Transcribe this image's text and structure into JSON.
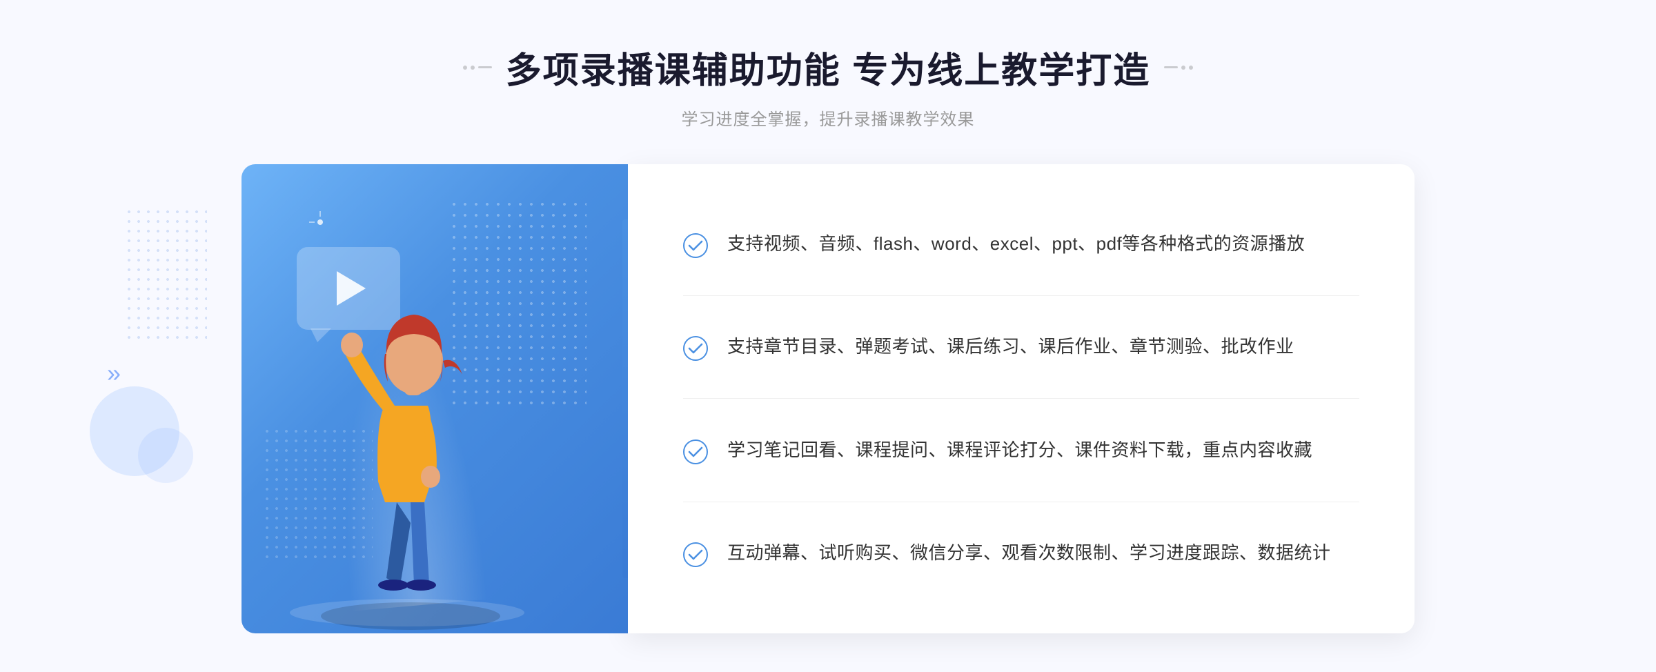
{
  "header": {
    "title": "多项录播课辅助功能 专为线上教学打造",
    "subtitle": "学习进度全掌握，提升录播课教学效果",
    "decoration_left": ":: ",
    "decoration_right": " ::"
  },
  "features": [
    {
      "id": 1,
      "text": "支持视频、音频、flash、word、excel、ppt、pdf等各种格式的资源播放"
    },
    {
      "id": 2,
      "text": "支持章节目录、弹题考试、课后练习、课后作业、章节测验、批改作业"
    },
    {
      "id": 3,
      "text": "学习笔记回看、课程提问、课程评论打分、课件资料下载，重点内容收藏"
    },
    {
      "id": 4,
      "text": "互动弹幕、试听购买、微信分享、观看次数限制、学习进度跟踪、数据统计"
    }
  ],
  "colors": {
    "primary_blue": "#4a90e2",
    "light_blue": "#6eb3f7",
    "text_dark": "#1a1a2e",
    "text_gray": "#999999",
    "text_body": "#333333",
    "bg_light": "#f8f9ff",
    "white": "#ffffff"
  }
}
